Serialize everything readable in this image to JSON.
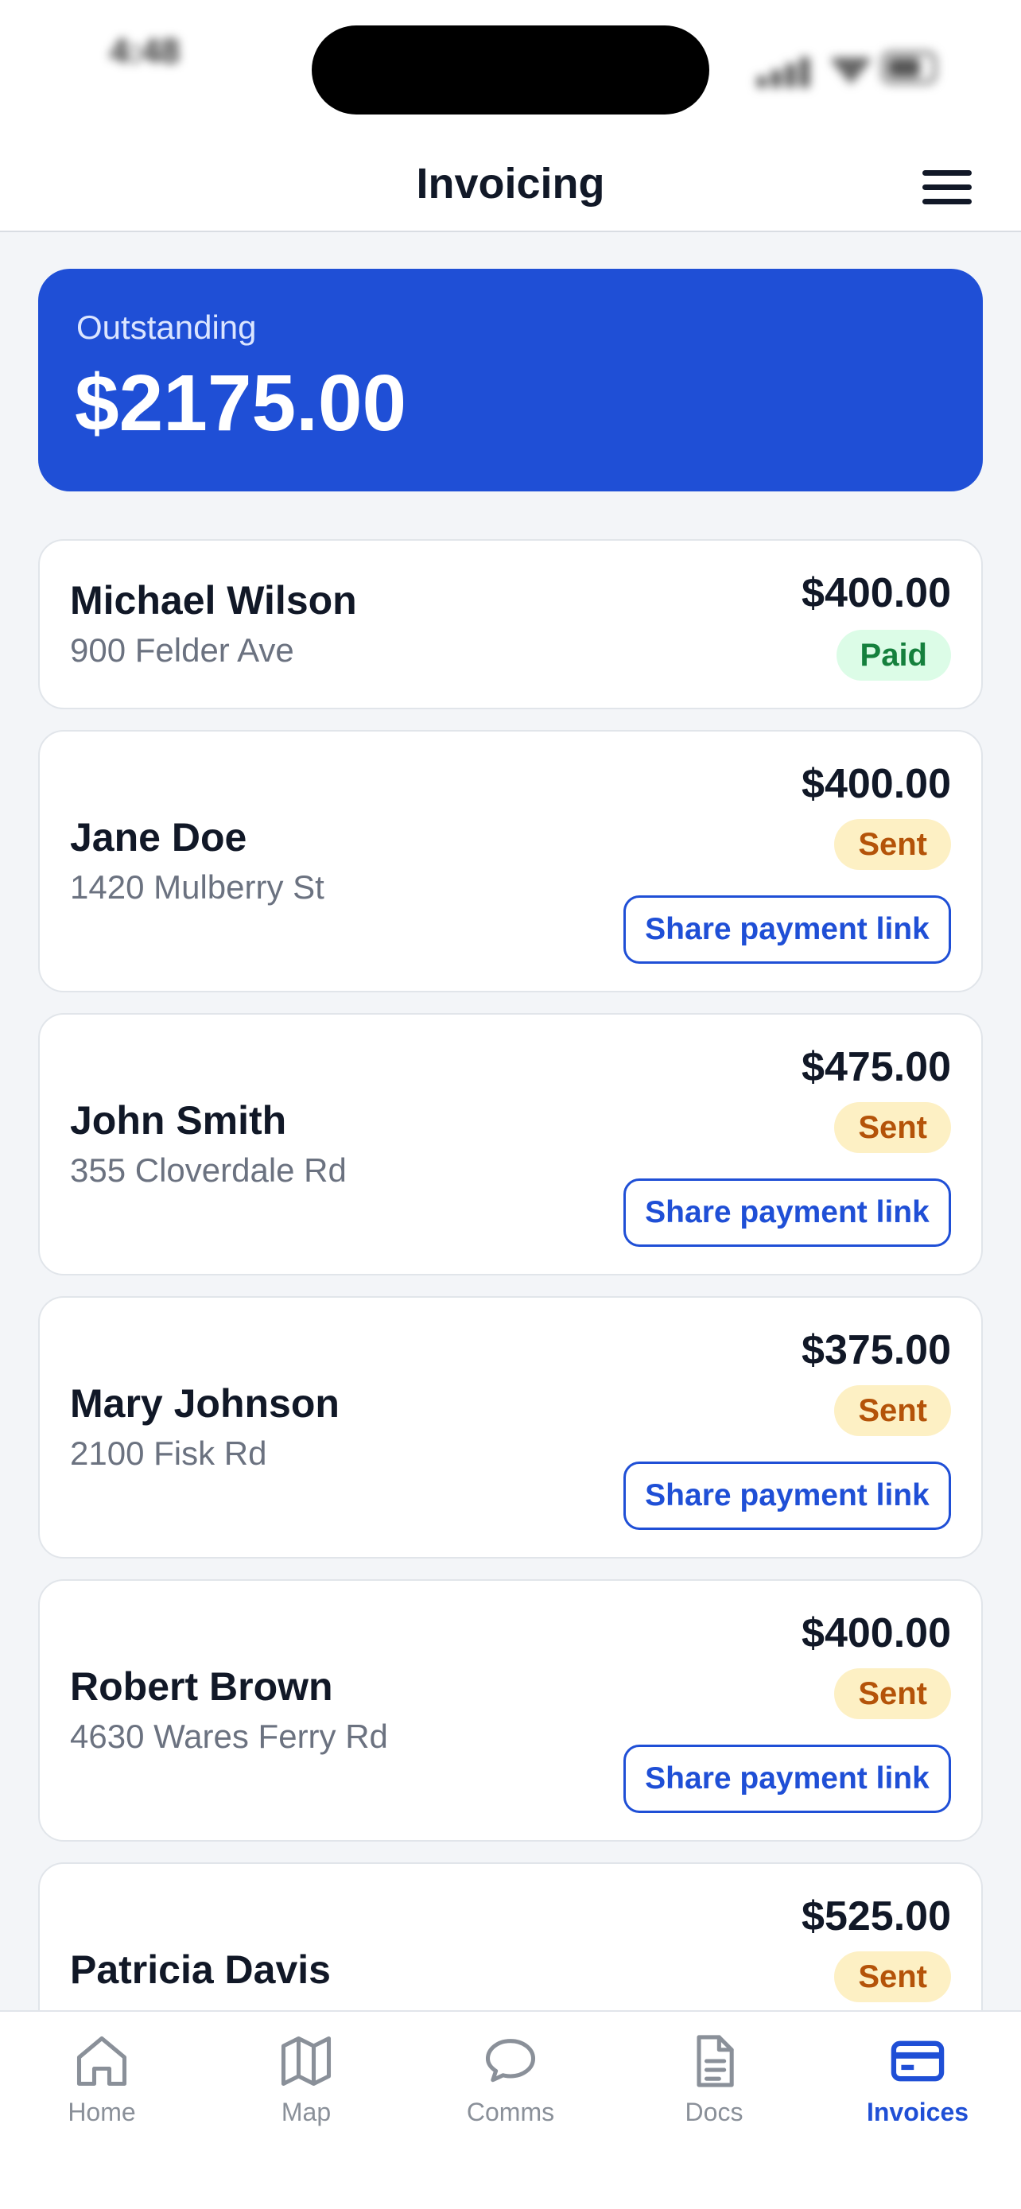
{
  "status_bar": {
    "time": "4:48"
  },
  "header": {
    "title": "Invoicing",
    "menu_icon": "hamburger-menu-icon"
  },
  "summary": {
    "label": "Outstanding",
    "amount": "$2175.00",
    "accent_color": "#1f4fd6"
  },
  "invoices": [
    {
      "name": "Michael Wilson",
      "address": "900 Felder Ave",
      "amount": "$400.00",
      "status": "Paid",
      "share_label": ""
    },
    {
      "name": "Jane Doe",
      "address": "1420 Mulberry St",
      "amount": "$400.00",
      "status": "Sent",
      "share_label": "Share payment link"
    },
    {
      "name": "John Smith",
      "address": "355 Cloverdale Rd",
      "amount": "$475.00",
      "status": "Sent",
      "share_label": "Share payment link"
    },
    {
      "name": "Mary Johnson",
      "address": "2100 Fisk Rd",
      "amount": "$375.00",
      "status": "Sent",
      "share_label": "Share payment link"
    },
    {
      "name": "Robert Brown",
      "address": "4630 Wares Ferry Rd",
      "amount": "$400.00",
      "status": "Sent",
      "share_label": "Share payment link"
    },
    {
      "name": "Patricia Davis",
      "address": "",
      "amount": "$525.00",
      "status": "Sent",
      "share_label": ""
    }
  ],
  "tabs": [
    {
      "label": "Home",
      "icon": "home-icon",
      "active": false
    },
    {
      "label": "Map",
      "icon": "map-icon",
      "active": false
    },
    {
      "label": "Comms",
      "icon": "chat-bubble-icon",
      "active": false
    },
    {
      "label": "Docs",
      "icon": "document-icon",
      "active": false
    },
    {
      "label": "Invoices",
      "icon": "credit-card-icon",
      "active": true
    }
  ],
  "colors": {
    "paid_text": "#15803d",
    "paid_bg": "#dcfce7",
    "sent_text": "#b45309",
    "sent_bg": "#fdf0c4",
    "active_tab": "#1f4fd6",
    "inactive_tab": "#8a9099"
  }
}
